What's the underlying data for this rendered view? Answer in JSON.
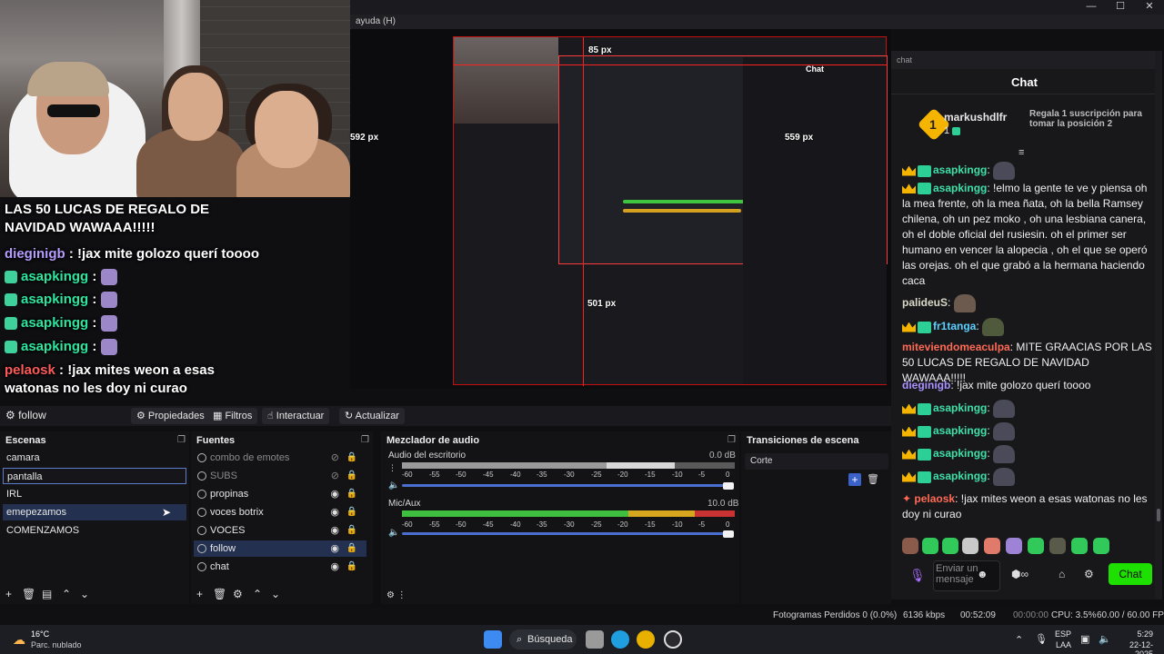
{
  "window": {
    "menu_fragment": "ayuda (H)",
    "controls": [
      "—",
      "☐",
      "✕"
    ]
  },
  "overlay_chat": {
    "announcement": "LAS 50 LUCAS DE REGALO DE NAVIDAD WAWAAA!!!!!",
    "messages": [
      {
        "user": "dieginigb",
        "text": " : !jax mite golozo querí toooo"
      },
      {
        "user": "asapkingg",
        "text": " : "
      },
      {
        "user": "asapkingg",
        "text": " : "
      },
      {
        "user": "asapkingg",
        "text": " : "
      },
      {
        "user": "asapkingg",
        "text": " : "
      },
      {
        "user": "pelaosk",
        "text": " : !jax mites weon a esas watonas no les doy ni curao"
      }
    ]
  },
  "preview": {
    "labels": [
      "85 px",
      "592 px",
      "559 px",
      "501 px"
    ],
    "mini_title": "Chat"
  },
  "source_toolbar": {
    "current_source": "follow",
    "buttons": [
      "Propiedades",
      "Filtros",
      "Interactuar",
      "Actualizar"
    ]
  },
  "scenes": {
    "title": "Escenas",
    "items": [
      "camara",
      "pantalla",
      "IRL",
      "emepezamos",
      "COMENZAMOS"
    ]
  },
  "sources": {
    "title": "Fuentes",
    "items": [
      "combo de emotes",
      "SUBS",
      "propinas",
      "voces botrix",
      "VOCES",
      "follow",
      "chat"
    ]
  },
  "mixer": {
    "title": "Mezclador de audio",
    "channels": [
      {
        "name": "Audio del escritorio",
        "db": "0.0 dB",
        "level": 0.82
      },
      {
        "name": "Mic/Aux",
        "db": "10.0 dB",
        "level": 1.0
      }
    ],
    "ticks": [
      "-60",
      "-55",
      "-50",
      "-45",
      "-40",
      "-35",
      "-30",
      "-25",
      "-20",
      "-15",
      "-10",
      "-5",
      "0"
    ]
  },
  "transitions": {
    "title": "Transiciones de escena",
    "selected": "Corte"
  },
  "status": {
    "dropped": "Fotogramas Perdidos 0 (0.0%)",
    "kbps": "6136 kbps",
    "live_time": "00:52:09",
    "rec_time": "00:00:00",
    "cpu": "CPU: 3.5%",
    "fps": "60.00 / 60.00 FPS"
  },
  "taskbar": {
    "weather_temp": "16°C",
    "weather_desc": "Parc. nublado",
    "search": "Búsqueda",
    "lang": "ESP",
    "lang2": "LAA",
    "time": "5:29",
    "date": "22-12-2025"
  },
  "chat": {
    "url_placeholder": "chat",
    "title": "Chat",
    "top_gifter": {
      "rank": "1",
      "name": "markushdlfr",
      "count": "1"
    },
    "gift_info": "Regala 1 suscripción para tomar la posición 2",
    "messages": [
      {
        "user": "asapkingg",
        "text": ": "
      },
      {
        "user": "asapkingg",
        "text": ": !elmo la gente te ve y piensa oh la mea frente, oh la mea ñata, oh la bella Ramsey chilena, oh un pez moko , oh una lesbiana canera, oh el doble oficial del rusiesin. oh el primer ser humano en vencer la alopecia , oh el que se operó las orejas. oh el que grabó a la hermana haciendo caca"
      },
      {
        "user": "palideuS",
        "text": ": "
      },
      {
        "user": "fr1tanga",
        "text": ": "
      },
      {
        "user": "miteviendomeaculpa",
        "text": ": MITE GRAACIAS POR LAS 50 LUCAS DE REGALO DE NAVIDAD WAWAAA!!!!!"
      },
      {
        "user": "dieginigb",
        "text": ": !jax mite golozo querí toooo"
      },
      {
        "user": "asapkingg",
        "text": ": "
      },
      {
        "user": "asapkingg",
        "text": ": "
      },
      {
        "user": "asapkingg",
        "text": ": "
      },
      {
        "user": "asapkingg",
        "text": ": "
      },
      {
        "user": "pelaosk",
        "text": ": !jax mites weon a esas watonas no les doy ni curao"
      }
    ],
    "input_placeholder": "Enviar un mensaje",
    "send_label": "Chat"
  }
}
